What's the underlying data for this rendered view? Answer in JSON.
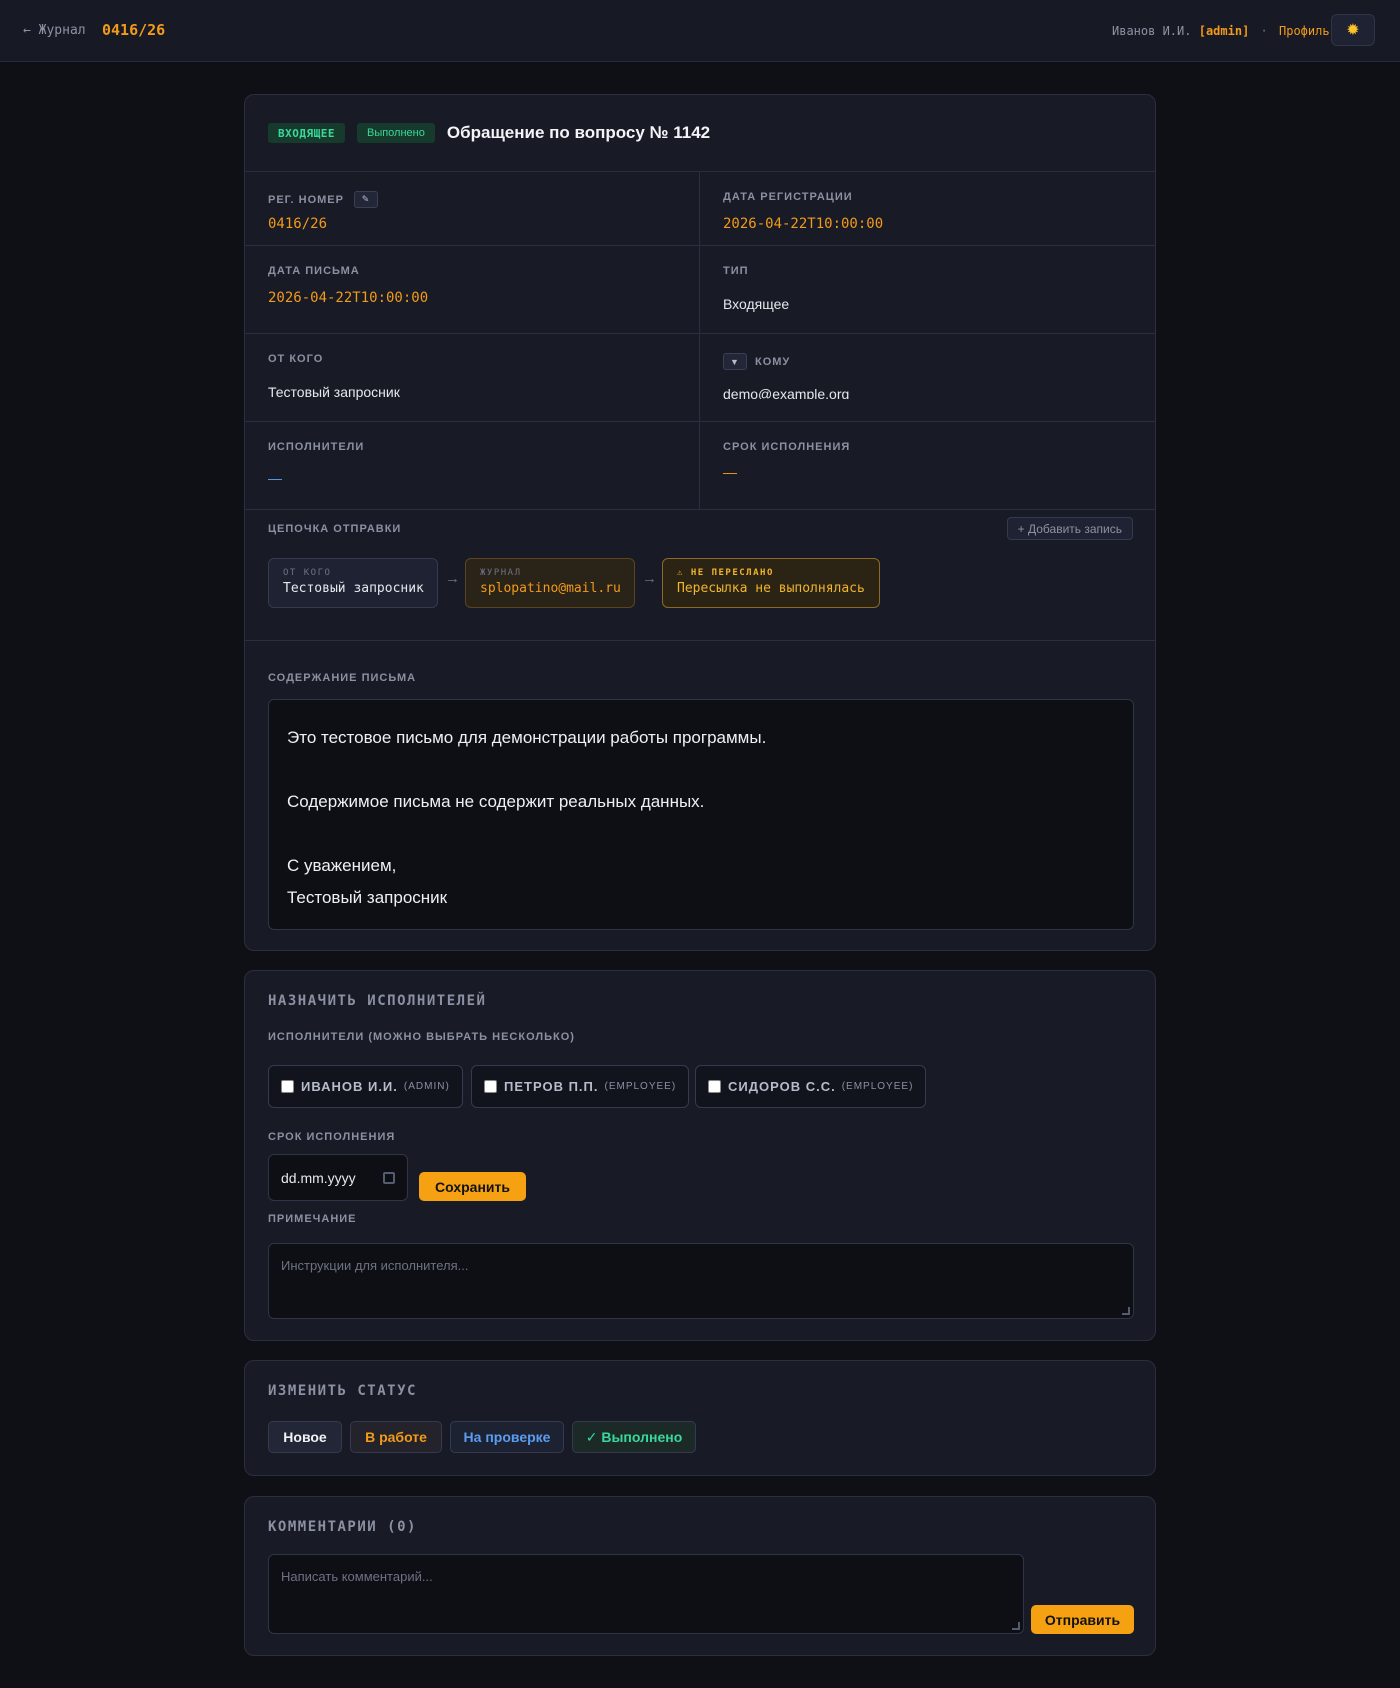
{
  "topbar": {
    "back_label": "← Журнал",
    "reg_number": "0416/26",
    "user_name": "Иванов И.И.",
    "user_role": "[admin]",
    "separator": "·",
    "profile_label": "Профиль",
    "theme_icon": "sun-icon"
  },
  "document": {
    "type_badge": "ВХОДЯЩЕЕ",
    "status_badge": "Выполнено",
    "title": "Обращение по вопросу № 1142",
    "fields": {
      "reg_number_label": "Рег. номер",
      "reg_number": "0416/26",
      "reg_date_label": "Дата регистрации",
      "reg_date": "2026-04-22T10:00:00",
      "letter_date_label": "Дата письма",
      "letter_date": "2026-04-22T10:00:00",
      "type_label": "Тип",
      "type_value": "Входящее",
      "from_label": "От кого",
      "from_value": "Тестовый запросник",
      "to_label": "Кому",
      "to_value": "demo@example.org",
      "executors_label": "Исполнители",
      "executors_value": "—",
      "deadline_label": "Срок исполнения",
      "deadline_value": "—"
    },
    "chain": {
      "label": "Цепочка отправки",
      "add_label": "+ Добавить запись",
      "nodes": [
        {
          "label": "ОТ КОГО",
          "value": "Тестовый запросник"
        },
        {
          "label": "ЖУРНАЛ",
          "value": "splopatino@mail.ru"
        },
        {
          "label": "⚠ НЕ ПЕРЕСЛАНО",
          "value": "Пересылка не выполнялась"
        }
      ],
      "arrow": "→"
    },
    "content": {
      "label": "Содержание письма",
      "lines": [
        "Это тестовое письмо для демонстрации работы программы.",
        "",
        "Содержимое письма не содержит реальных данных.",
        "",
        "С уважением,",
        "Тестовый запросник"
      ]
    }
  },
  "assign": {
    "title": "НАЗНАЧИТЬ ИСПОЛНИТЕЛЕЙ",
    "executors_label": "Исполнители (можно выбрать несколько)",
    "people": [
      {
        "name": "ИВАНОВ И.И.",
        "role": "(ADMIN)"
      },
      {
        "name": "ПЕТРОВ П.П.",
        "role": "(EMPLOYEE)"
      },
      {
        "name": "СИДОРОВ С.С.",
        "role": "(EMPLOYEE)"
      }
    ],
    "deadline_label": "Срок исполнения",
    "date_placeholder": "dd.mm.yyyy",
    "save_label": "Сохранить",
    "note_label": "Примечание",
    "note_placeholder": "Инструкции для исполнителя..."
  },
  "status": {
    "title": "ИЗМЕНИТЬ СТАТУС",
    "buttons": {
      "new": "Новое",
      "in_work": "В работе",
      "review": "На проверке",
      "done": "✓ Выполнено"
    }
  },
  "comments": {
    "title": "КОММЕНТАРИИ (0)",
    "placeholder": "Написать комментарий...",
    "send_label": "Отправить"
  },
  "colors": {
    "accent": "#f29a19",
    "success": "#3ad89a",
    "info": "#5a9df0",
    "background": "#0f1016",
    "card": "#181a26"
  }
}
